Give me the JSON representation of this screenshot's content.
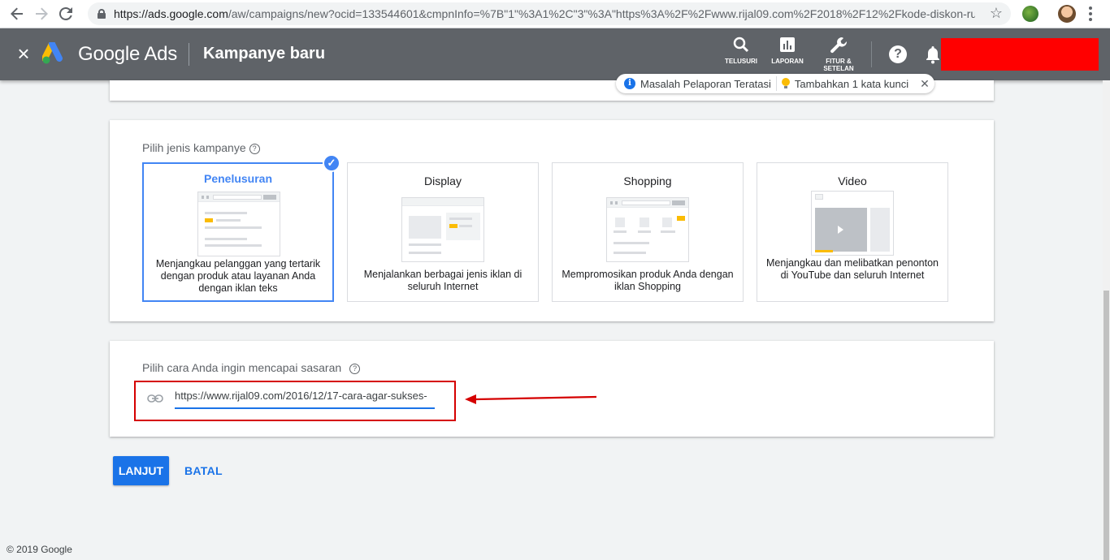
{
  "browser": {
    "url_host": "https://ads.google.com",
    "url_rest": "/aw/campaigns/new?ocid=133544601&cmpnInfo=%7B\"1\"%3A1%2C\"3\"%3A\"https%3A%2F%2Fwww.rijal09.com%2F2018%2F12%2Fkode-diskon-ru...",
    "back_icon": "arrow-left-icon",
    "forward_icon": "arrow-right-icon",
    "reload_icon": "reload-icon"
  },
  "appbar": {
    "brand": "Google Ads",
    "page_title": "Kampanye baru",
    "tools": [
      {
        "label": "TELUSURI",
        "icon": "search-icon"
      },
      {
        "label": "LAPORAN",
        "icon": "chart-icon"
      },
      {
        "label": "FITUR & SETELAN",
        "icon": "wrench-icon"
      }
    ],
    "help": "?"
  },
  "notification": {
    "item1": "Masalah Pelaporan Teratasi",
    "item2": "Tambahkan 1 kata kunci",
    "info_glyph": "i",
    "close_glyph": "✕"
  },
  "campaign_type": {
    "label": "Pilih jenis kampanye",
    "tiles": [
      {
        "title": "Penelusuran",
        "desc": "Menjangkau pelanggan yang tertarik dengan produk atau layanan Anda dengan iklan teks",
        "selected": true
      },
      {
        "title": "Display",
        "desc": "Menjalankan berbagai jenis iklan di seluruh Internet",
        "selected": false
      },
      {
        "title": "Shopping",
        "desc": "Mempromosikan produk Anda dengan iklan Shopping",
        "selected": false
      },
      {
        "title": "Video",
        "desc": "Menjangkau dan melibatkan penonton di YouTube dan seluruh Internet",
        "selected": false
      }
    ]
  },
  "goal": {
    "label": "Pilih cara Anda ingin mencapai sasaran",
    "url_value": "https://www.rijal09.com/2016/12/17-cara-agar-sukses-"
  },
  "actions": {
    "next": "LANJUT",
    "cancel": "BATAL"
  },
  "footer": "© 2019 Google",
  "colors": {
    "appbar": "#5f6368",
    "accent": "#4285f4",
    "annotation": "#d50000",
    "redaction": "#ff0000"
  }
}
